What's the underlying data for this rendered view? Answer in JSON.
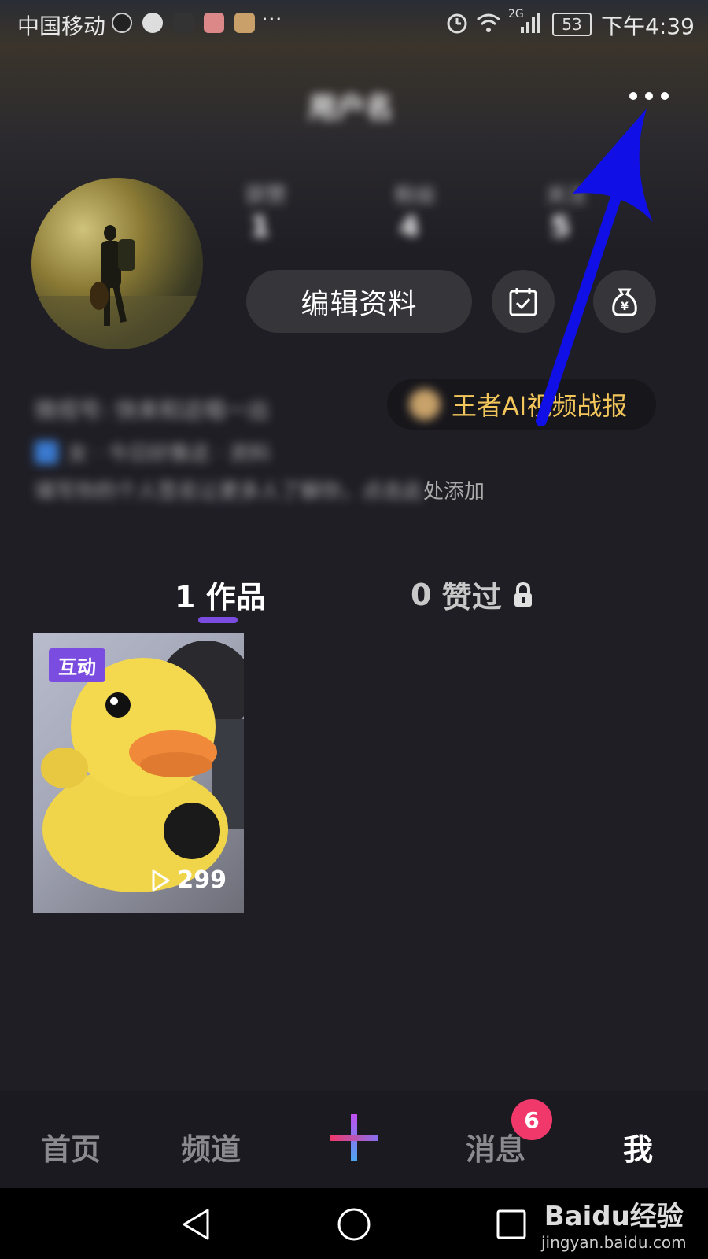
{
  "status_bar": {
    "carrier": "中国移动",
    "more": "···",
    "network": "2G",
    "battery": "53",
    "time": "下午4:39"
  },
  "header": {
    "title_blurred": "用户名",
    "stats": [
      {
        "label": "获赞",
        "value": "1"
      },
      {
        "label": "粉丝",
        "value": "4"
      },
      {
        "label": "关注",
        "value": "5"
      }
    ]
  },
  "profile": {
    "edit_label": "编辑资料",
    "bio_line1_blurred": "微视号: 快来和这唱一出",
    "bio_line2_blurred": "女 · 今日好像这 · 资料",
    "bio_line3_visible_tail": "处添加",
    "bio_line3_blurred": "填写你的个人签名让更多人了解你，点击此"
  },
  "promo": {
    "label": "王者AI视频战报"
  },
  "tabs": [
    {
      "count": "1",
      "label": "作品"
    },
    {
      "count": "0",
      "label": "赞过"
    }
  ],
  "video": {
    "tag": "互动",
    "plays": "299"
  },
  "bottom_nav": {
    "home": "首页",
    "channel": "频道",
    "messages": "消息",
    "messages_badge": "6",
    "me": "我"
  },
  "watermark": {
    "brand": "Baidu经验",
    "url": "jingyan.baidu.com"
  },
  "colors": {
    "accent_purple": "#7a4ce0",
    "promo_gold": "#f2c65a",
    "badge_red": "#f0386b",
    "annotation_arrow": "#1010e6"
  }
}
